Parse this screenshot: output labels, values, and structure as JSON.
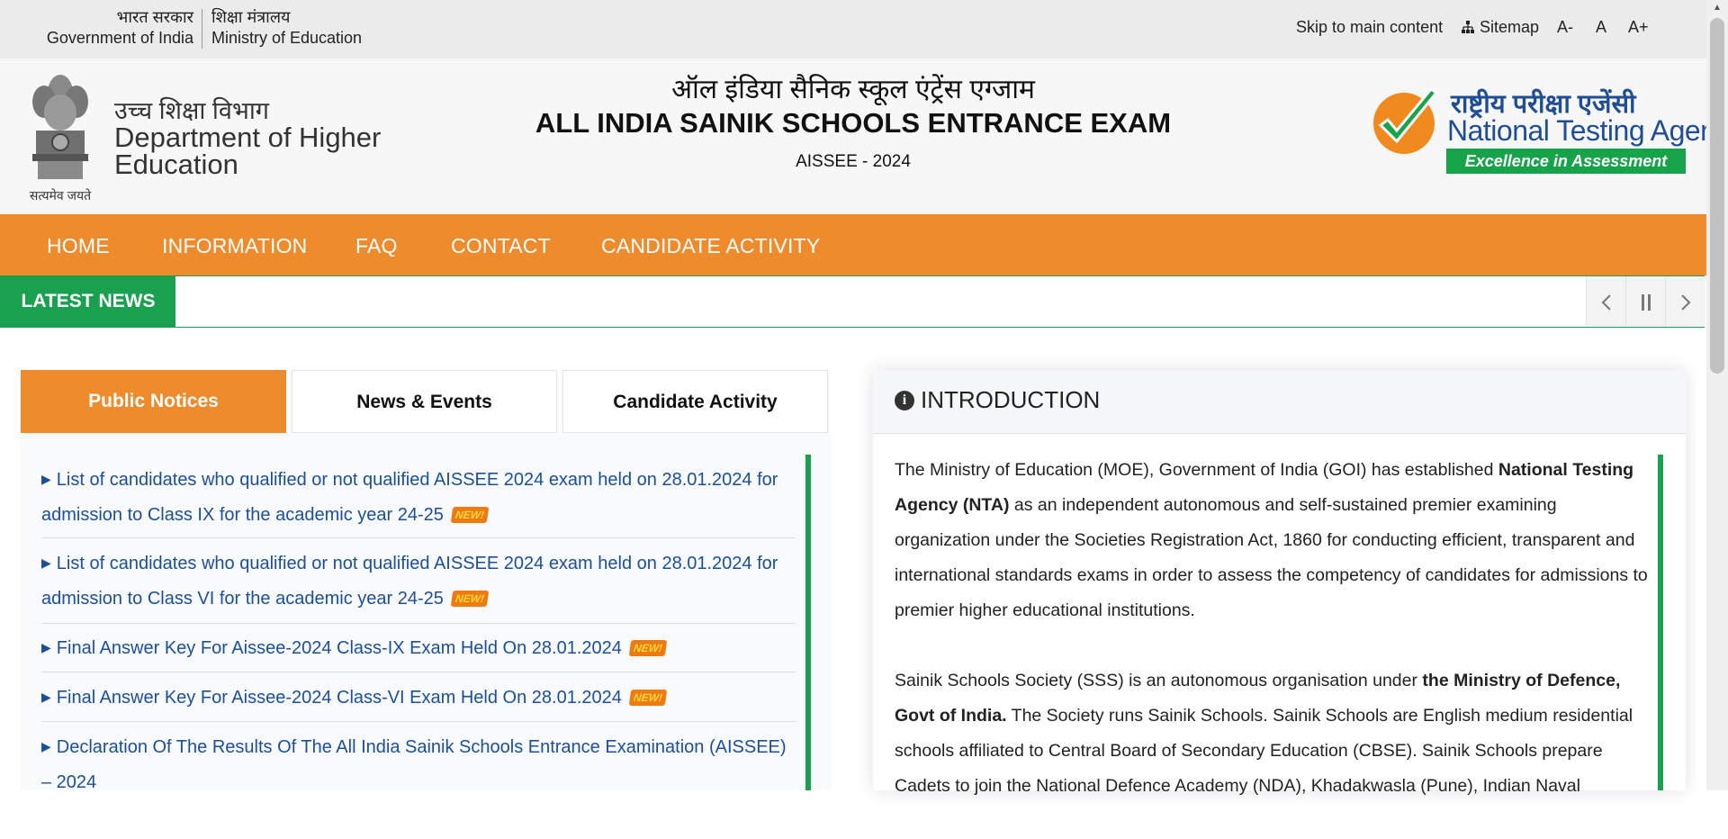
{
  "topbar": {
    "gov_hi": "भारत सरकार",
    "gov_en": "Government of India",
    "ministry_hi": "शिक्षा मंत्रालय",
    "ministry_en": "Ministry of Education",
    "skip": "Skip to main content",
    "sitemap": "Sitemap",
    "font_dec": "A-",
    "font_normal": "A",
    "font_inc": "A+"
  },
  "header": {
    "emblem_motto": "सत्यमेव जयते",
    "dept_hi": "उच्च शिक्षा विभाग",
    "dept_en_line1": "Department of Higher",
    "dept_en_line2": "Education",
    "exam_hi": "ऑल इंडिया सैनिक स्कूल एंट्रेंस एग्जाम",
    "exam_title": "ALL INDIA SAINIK SCHOOLS ENTRANCE EXAM",
    "exam_sub": "AISSEE - 2024",
    "nta_hi": "राष्ट्रीय परीक्षा एजेंसी",
    "nta_en": "National Testing Agency",
    "nta_tagline": "Excellence in Assessment"
  },
  "nav": {
    "items": [
      "HOME",
      "INFORMATION",
      "FAQ",
      "CONTACT",
      "CANDIDATE ACTIVITY"
    ]
  },
  "news": {
    "label": "LATEST NEWS",
    "controls": [
      "prev-icon",
      "pause-icon",
      "next-icon"
    ]
  },
  "tabs": {
    "items": [
      "Public Notices",
      "News & Events",
      "Candidate Activity"
    ],
    "active": "Public Notices"
  },
  "notices": [
    {
      "text": "List of candidates who qualified or not qualified AISSEE 2024 exam held on 28.01.2024 for admission to Class IX for the academic year 24-25",
      "is_new": true
    },
    {
      "text": "List of candidates who qualified or not qualified AISSEE 2024 exam held on 28.01.2024 for admission to Class VI for the academic year 24-25",
      "is_new": true
    },
    {
      "text": "Final Answer Key For Aissee-2024 Class-IX Exam Held On 28.01.2024",
      "is_new": true
    },
    {
      "text": "Final Answer Key For Aissee-2024 Class-VI Exam Held On 28.01.2024",
      "is_new": true
    },
    {
      "text": "Declaration Of The Results Of The All India Sainik Schools Entrance Examination (AISSEE) – 2024",
      "is_new": false
    }
  ],
  "new_badge": "NEW!",
  "intro": {
    "title": "INTRODUCTION",
    "p1_a": "The Ministry of Education (MOE), Government of India (GOI) has established ",
    "p1_b": "National Testing Agency (NTA)",
    "p1_c": " as an independent autonomous and self-sustained premier examining organization under the Societies Registration Act, 1860 for conducting efficient, transparent and international standards exams in order to assess the competency of candidates for admissions to premier higher educational institutions.",
    "p2_a": "Sainik Schools Society (SSS) is an autonomous organisation under ",
    "p2_b": "the Ministry of Defence, Govt of India.",
    "p2_c": " The Society runs Sainik Schools. Sainik Schools are English medium residential schools affiliated to Central Board of Secondary Education (CBSE). Sainik Schools prepare Cadets to join the National Defence Academy (NDA), Khadakwasla (Pune), Indian Naval"
  },
  "colors": {
    "nav_orange": "#ee8b2c",
    "news_green": "#1aa150",
    "link_blue": "#1b4f9c",
    "nta_blue": "#1f4e96"
  }
}
